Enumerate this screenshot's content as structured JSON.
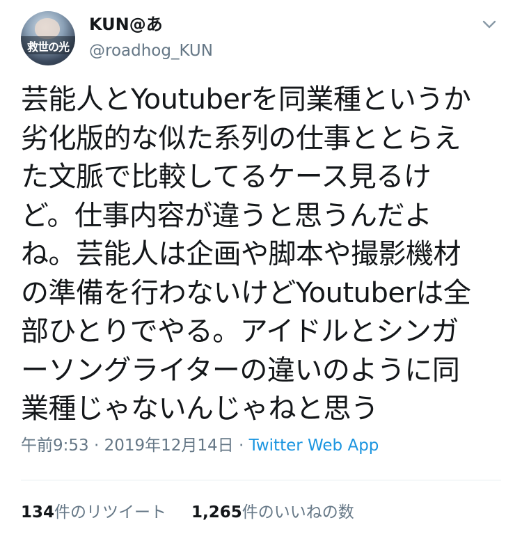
{
  "user": {
    "display_name": "KUN@あ",
    "handle": "@roadhog_KUN",
    "avatar_text": "救世の光",
    "avatar_icon": "profile-photo"
  },
  "menu_icon": "chevron-down-icon",
  "tweet": {
    "text": "芸能人とYoutuberを同業種というか\n劣化版的な似た系列の仕事ととらえ\nた文脈で比較してるケース見るけ\nど。仕事内容が違うと思うんだよ\nね。芸能人は企画や脚本や撮影機材\nの準備を行わないけどYoutuberは全\n部ひとりでやる。アイドルとシンガ\nーソングライターの違いのように同\n業種じゃないんじゃねと思う"
  },
  "meta": {
    "time": "午前9:53",
    "separator": "·",
    "date": "2019年12月14日",
    "source": "Twitter Web App"
  },
  "stats": {
    "retweets_count": "134",
    "retweets_label": "件のリツイート",
    "likes_count": "1,265",
    "likes_label": "件のいいねの数"
  },
  "colors": {
    "text": "#14171a",
    "secondary": "#657786",
    "link": "#1b95e0",
    "divider": "#e6ecf0"
  }
}
